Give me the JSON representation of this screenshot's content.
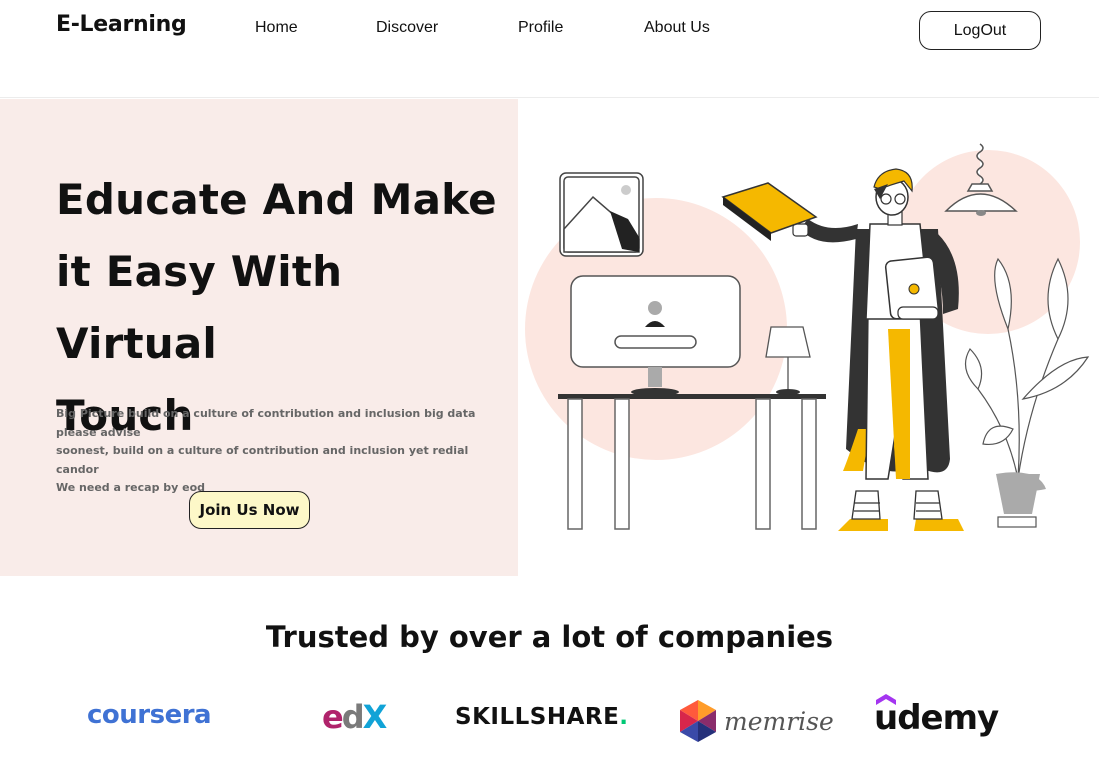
{
  "nav": {
    "brand": "E-Learning",
    "links": [
      "Home",
      "Discover",
      "Profile",
      "About Us"
    ],
    "logout_label": "LogOut"
  },
  "hero": {
    "title_lines": [
      "Educate And Make",
      "it Easy With Virtual",
      "Touch"
    ],
    "description_lines": [
      "Big Picture build on a culture of contribution and inclusion big data please advise",
      "soonest, build on a culture of contribution and inclusion yet redial candor",
      "We need a recap by eod"
    ],
    "cta_label": "Join Us Now"
  },
  "trusted": {
    "title": "Trusted by over a lot of companies",
    "logos": [
      {
        "name": "coursera",
        "text": "coursera"
      },
      {
        "name": "edx",
        "parts": [
          "e",
          "d",
          "X"
        ]
      },
      {
        "name": "skillshare",
        "text": "SKILLSHARE",
        "dot": "."
      },
      {
        "name": "memrise",
        "text": "memrise"
      },
      {
        "name": "udemy",
        "text": "udemy"
      }
    ]
  },
  "colors": {
    "hero_bg": "#f9ece9",
    "accent_yellow": "#f5b800",
    "button_yellow": "#fdf8c8",
    "circle_pink": "#fce6e0",
    "coursera_blue": "#3f72d4",
    "edx_magenta": "#b0236b",
    "edx_blue": "#11a3d7",
    "skillshare_green": "#00c875",
    "udemy_purple": "#a435f0"
  }
}
